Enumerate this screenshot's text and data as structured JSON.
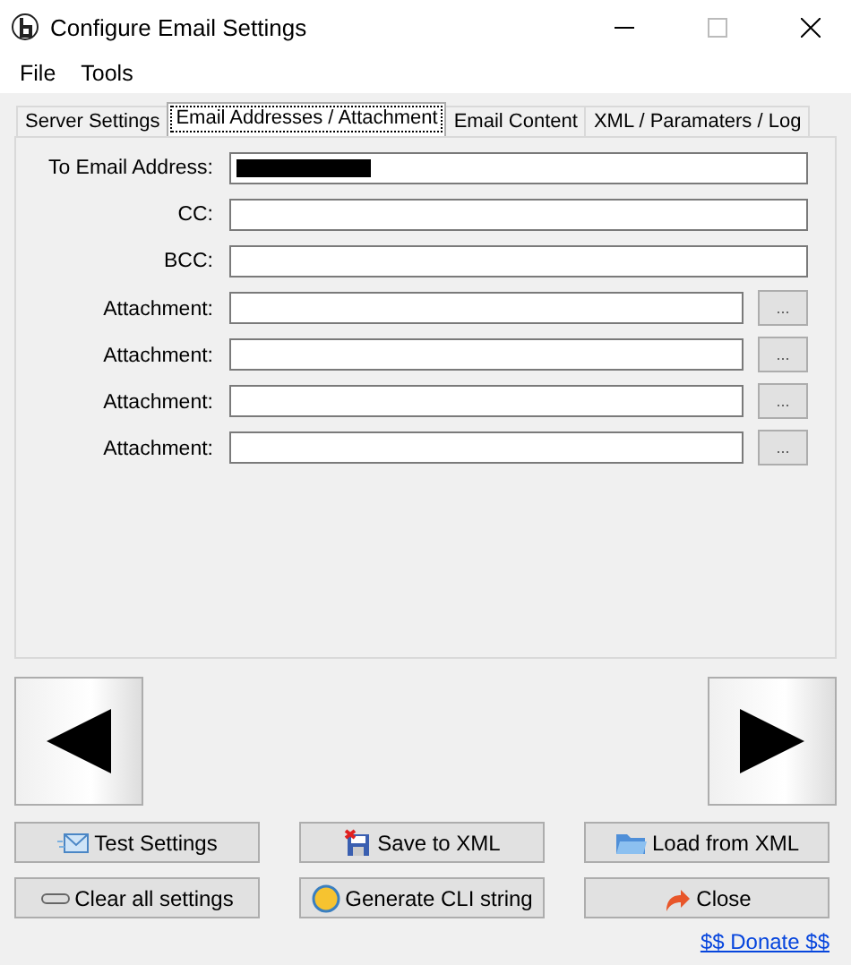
{
  "window": {
    "title": "Configure Email Settings"
  },
  "menu": [
    "File",
    "Tools"
  ],
  "tabs": [
    {
      "label": "Server Settings",
      "selected": false
    },
    {
      "label": "Email Addresses / Attachment",
      "selected": true
    },
    {
      "label": "Email Content",
      "selected": false
    },
    {
      "label": "XML / Paramaters / Log",
      "selected": false
    }
  ],
  "fields": [
    {
      "kind": "address",
      "label": "To Email Address:",
      "redacted": true
    },
    {
      "kind": "address",
      "label": "CC:",
      "redacted": false
    },
    {
      "kind": "address",
      "label": "BCC:",
      "redacted": false
    },
    {
      "kind": "attachment",
      "label": "Attachment:",
      "browse": "..."
    },
    {
      "kind": "attachment",
      "label": "Attachment:",
      "browse": "..."
    },
    {
      "kind": "attachment",
      "label": "Attachment:",
      "browse": "..."
    },
    {
      "kind": "attachment",
      "label": "Attachment:",
      "browse": "..."
    }
  ],
  "actions": [
    {
      "label": "Test Settings",
      "kind": "mail"
    },
    {
      "label": "Save to XML",
      "kind": "save"
    },
    {
      "label": "Load from XML",
      "kind": "folder"
    },
    {
      "label": "Clear all settings",
      "kind": "clear"
    },
    {
      "label": "Generate CLI string",
      "kind": "yes"
    },
    {
      "label": "Close",
      "kind": "close"
    }
  ],
  "donate_link": "$$ Donate $$"
}
